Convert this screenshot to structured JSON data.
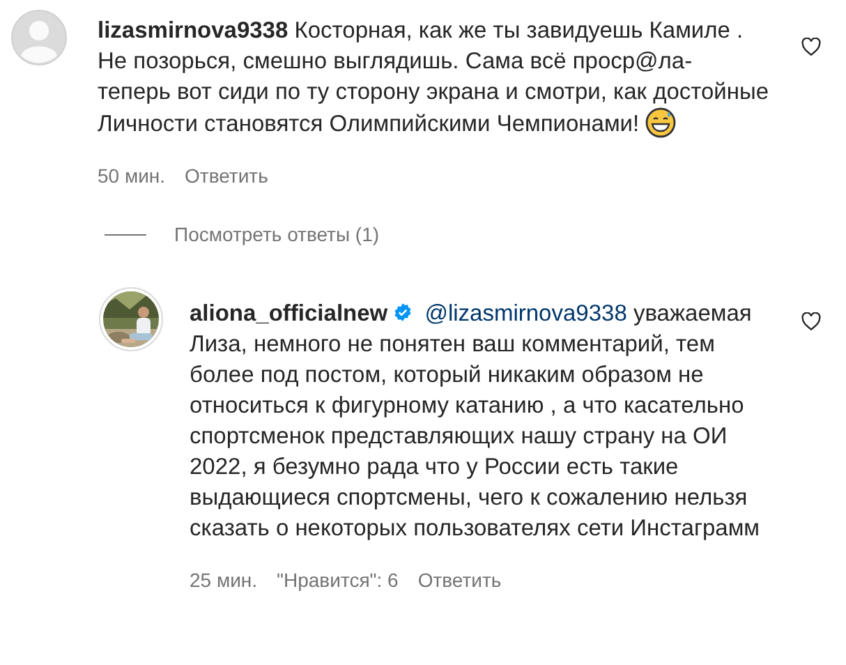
{
  "comments": [
    {
      "kind": "plain",
      "has_photo": false,
      "username": "lizasmirnova9338",
      "verified": false,
      "text": "Косторная, как же ты завидуешь Камиле . Не позорься, смешно выглядишь. Сама всё проср@ла- теперь вот сиди по ту сторону экрана и смотри, как достойные Личности становятся Олимпийскими Чемпионами!",
      "emoji": true,
      "time": "50 мин.",
      "reply": "Ответить",
      "liked": false,
      "view_replies": "Посмотреть ответы (1)"
    },
    {
      "kind": "reply",
      "has_photo": true,
      "username": "aliona_officialnew",
      "verified": true,
      "mention": "@lizasmirnova9338",
      "text": "уважаемая Лиза, немного не понятен ваш комментарий, тем более под постом, который никаким образом не относиться к фигурному катанию , а что касательно спортсменок представляющих нашу страну на ОИ 2022, я безумно рада что у России есть такие выдающиеся спортсмены, чего к сожалению нельзя сказать о некоторых пользователях сети Инстаграмм",
      "emoji": false,
      "time": "25 мин.",
      "likes": "\"Нравится\": 6",
      "reply": "Ответить",
      "liked": false
    }
  ]
}
